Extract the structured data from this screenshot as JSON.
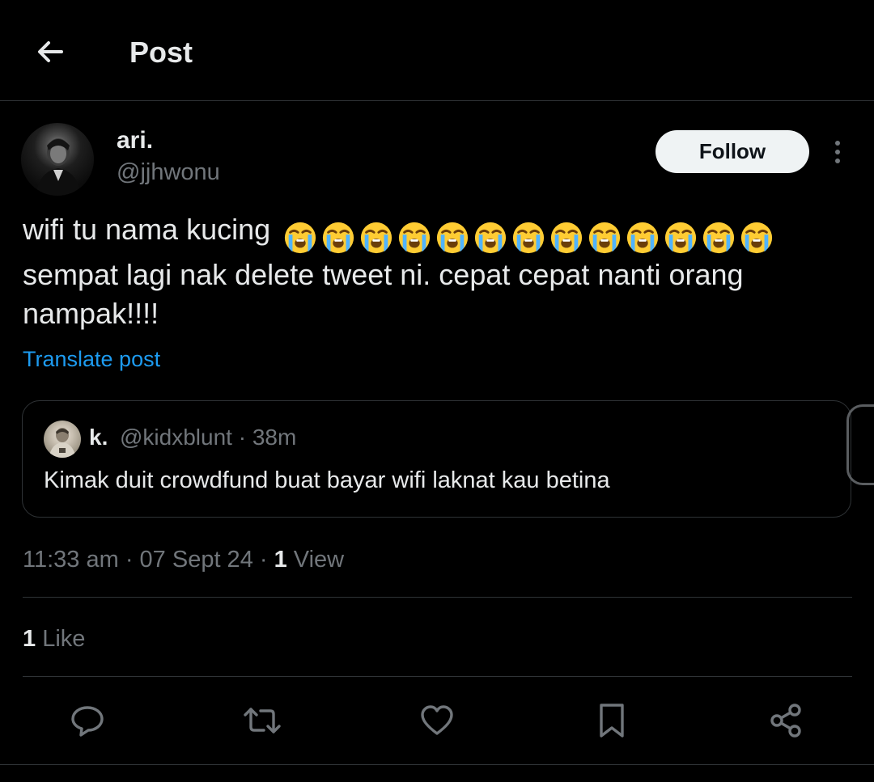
{
  "header": {
    "title": "Post",
    "back_icon": "arrow-left-icon"
  },
  "author": {
    "display_name": "ari.",
    "handle": "@jjhwonu",
    "follow_label": "Follow",
    "more_icon": "more-vertical-icon"
  },
  "post": {
    "text_before_emoji": "wifi tu nama kucing",
    "emoji": "loudly-crying-face",
    "emoji_count": 13,
    "text_after_emoji": "sempat lagi nak delete tweet ni. cepat cepat nanti orang nampak!!!!",
    "translate_label": "Translate post"
  },
  "quote": {
    "name": "k.",
    "handle_time": "@kidxblunt · 38m",
    "text": "Kimak duit crowdfund buat bayar wifi laknat kau betina"
  },
  "meta": {
    "timestamp": "11:33 am · 07 Sept 24 · ",
    "view_count": "1",
    "view_label": " View"
  },
  "likes": {
    "count": "1",
    "label": " Like"
  },
  "actions": {
    "reply_icon": "reply-icon",
    "repost_icon": "repost-icon",
    "like_icon": "heart-icon",
    "bookmark_icon": "bookmark-icon",
    "share_icon": "share-icon"
  },
  "colors": {
    "background": "#000000",
    "text_primary": "#e7e9ea",
    "text_secondary": "#71767b",
    "link": "#1d9bf0",
    "border": "#2f3336",
    "follow_button_bg": "#eff3f4"
  }
}
